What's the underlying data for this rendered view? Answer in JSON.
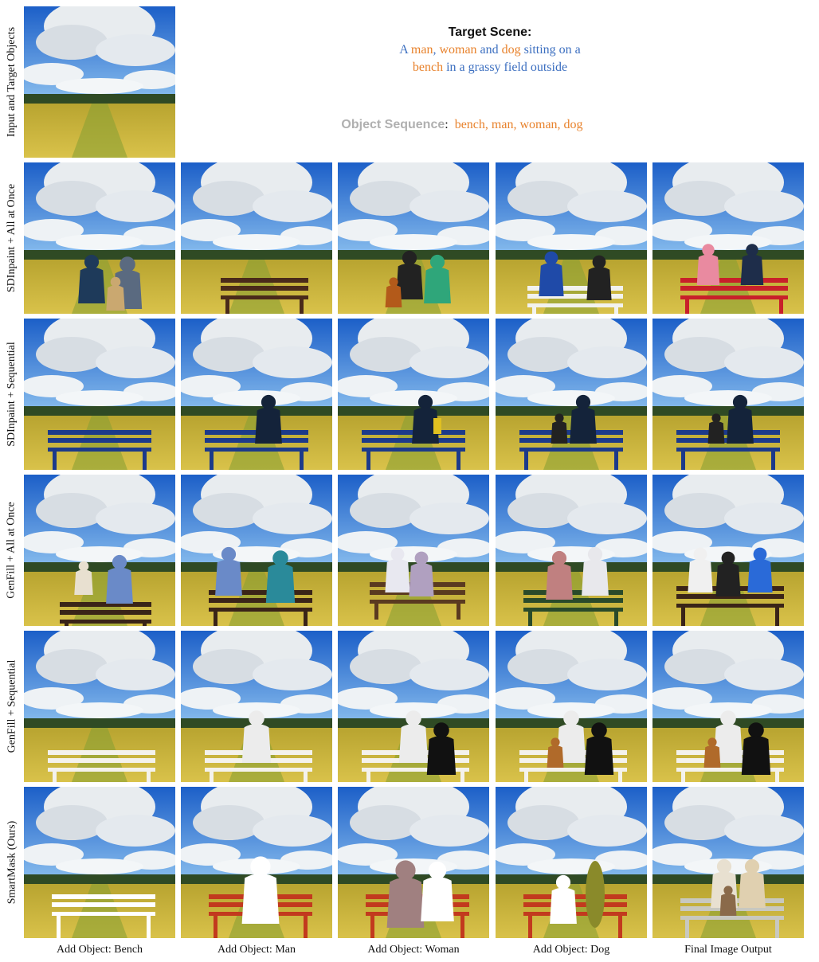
{
  "header": {
    "target_title": "Target Scene:",
    "target_segments": [
      {
        "text": "A ",
        "color": "#3c6fc0"
      },
      {
        "text": "man",
        "color": "#e8822c"
      },
      {
        "text": ", ",
        "color": "#3c6fc0"
      },
      {
        "text": "woman",
        "color": "#e8822c"
      },
      {
        "text": " and ",
        "color": "#3c6fc0"
      },
      {
        "text": "dog",
        "color": "#e8822c"
      },
      {
        "text": " sitting on a",
        "color": "#3c6fc0"
      },
      {
        "text": "bench",
        "color": "#e8822c"
      },
      {
        "text": " in a grassy field outside",
        "color": "#3c6fc0"
      }
    ],
    "sequence_label": "Object Sequence",
    "sequence_colon": ":",
    "sequence_items": "bench, man, woman, dog",
    "sequence_color": "#e8822c"
  },
  "rows": [
    {
      "label": "Input and Target Objects"
    },
    {
      "label": "SDInpaint + All at Once"
    },
    {
      "label": "SDInpaint + Sequential"
    },
    {
      "label": "GenFill + All at Once"
    },
    {
      "label": "GenFill + Sequential"
    },
    {
      "label": "SmartMask (Ours)"
    }
  ],
  "columns": [
    {
      "caption": "Add Object: Bench"
    },
    {
      "caption": "Add Object: Man"
    },
    {
      "caption": "Add Object: Woman"
    },
    {
      "caption": "Add Object: Dog"
    },
    {
      "caption": "Final Image Output"
    }
  ],
  "colors": {
    "sky": "#2a7de0",
    "cloud": "#e8ecef",
    "field": "#c9b23a",
    "trees": "#2f4a24",
    "mask_white": "#ffffff",
    "mask_red": "#c23a1e",
    "mask_mauve": "#a08080",
    "mask_olive": "#8a8a2a"
  }
}
